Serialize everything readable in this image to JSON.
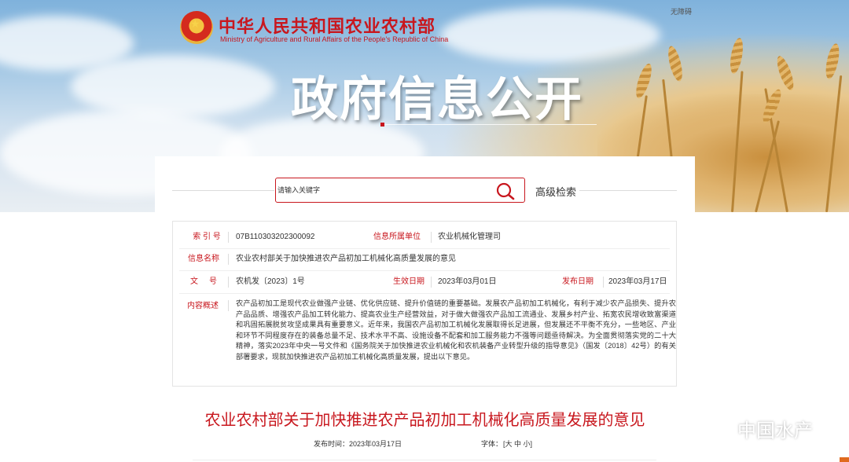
{
  "header": {
    "ministry_name_cn": "中华人民共和国农业农村部",
    "ministry_name_en": "Ministry of Agriculture and Rural Affairs of the People's Republic of China",
    "accessibility_link": "无障碍",
    "banner_title": "政府信息公开"
  },
  "search": {
    "placeholder": "请输入关键字",
    "icon": "search-icon",
    "advanced_label": "高级检索"
  },
  "info": {
    "index_label": "索 引 号",
    "index_value": "07B110303202300092",
    "org_label": "信息所属单位",
    "org_value": "农业机械化管理司",
    "name_label": "信息名称",
    "name_value": "农业农村部关于加快推进农产品初加工机械化高质量发展的意见",
    "docno_label": "文     号",
    "docno_value": "农机发〔2023〕1号",
    "effective_label": "生效日期",
    "effective_value": "2023年03月01日",
    "published_label": "发布日期",
    "published_value": "2023年03月17日",
    "summary_label": "内容概述",
    "summary_text": "农产品初加工是现代农业做强产业链、优化供应链、提升价值链的重要基础。发展农产品初加工机械化，有利于减少农产品损失、提升农产品品质、增强农产品加工转化能力、提高农业生产经营效益，对于做大做强农产品加工流通业、发展乡村产业、拓宽农民增收致富渠道和巩固拓展脱贫攻坚成果具有重要意义。近年来，我国农产品初加工机械化发展取得长足进展，但发展还不平衡不充分，一些地区、产业和环节不同程度存在的装备总量不足、技术水平不高、设施设备不配套和加工服务能力不强等问题亟待解决。为全面贯彻落实党的二十大精神，落实2023年中央一号文件和《国务院关于加快推进农业机械化和农机装备产业转型升级的指导意见》（国发〔2018〕42号）的有关部署要求，现就加快推进农产品初加工机械化高质量发展，提出以下意见。"
  },
  "document": {
    "title": "农业农村部关于加快推进农产品初加工机械化高质量发展的意见",
    "publish_date": "发布时间：2023年03月17日",
    "font_size_label": "字体：",
    "font_size_options": "[大 中 小]"
  },
  "watermark": {
    "icon": "wechat-icon",
    "text": "中国水产"
  },
  "colors": {
    "accent_red": "#c8171e",
    "body_text": "#333333"
  }
}
